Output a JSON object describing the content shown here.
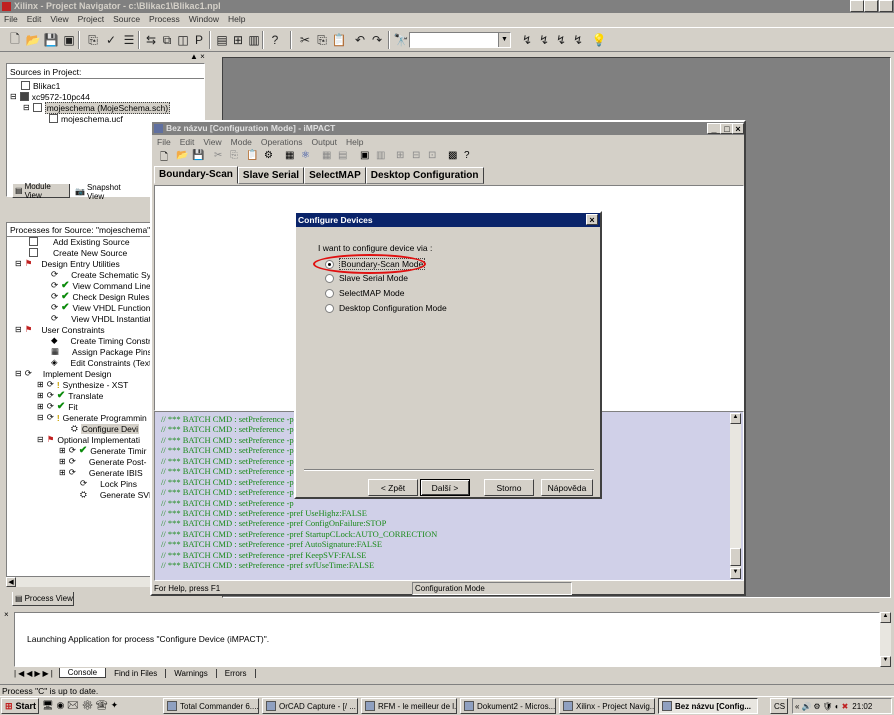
{
  "main_window": {
    "title": "Xilinx - Project Navigator - c:\\Blikac1\\Blikac1.npl",
    "menu": [
      "File",
      "Edit",
      "View",
      "Project",
      "Source",
      "Process",
      "Window",
      "Help"
    ]
  },
  "sources": {
    "header": "Sources in Project:",
    "items": [
      "Blikac1",
      "xc9572-10pc44",
      "mojeschema (MojeSchema.sch)",
      "mojeschema.ucf"
    ],
    "tabs": [
      "Module View",
      "Snapshot View"
    ]
  },
  "processes": {
    "header": "Processes for Source: \"mojeschema\"",
    "items": [
      "Add Existing Source",
      "Create New Source",
      "Design Entry Utilities",
      "Create Schematic Syn",
      "View Command Line I",
      "Check Design Rules",
      "View VHDL Functiona",
      "View VHDL Instantiat",
      "User Constraints",
      "Create Timing Constra",
      "Assign Package Pins",
      "Edit Constraints (Text",
      "Implement Design",
      "Synthesize - XST",
      "Translate",
      "Fit",
      "Generate Programmin",
      "Configure Devi",
      "Optional Implementati",
      "Generate Timir",
      "Generate Post-",
      "Generate IBIS",
      "Lock Pins",
      "Generate SVF/"
    ],
    "tab": "Process View"
  },
  "impact": {
    "title": "Bez názvu [Configuration Mode] - iMPACT",
    "menu": [
      "File",
      "Edit",
      "View",
      "Mode",
      "Operations",
      "Output",
      "Help"
    ],
    "tabs": [
      "Boundary-Scan",
      "Slave Serial",
      "SelectMAP",
      "Desktop Configuration"
    ],
    "log": [
      "// *** BATCH CMD : setPreference -pref UseHighz:FALSE",
      "// *** BATCH CMD : setPreference -pref ConfigOnFailure:STOP",
      "// *** BATCH CMD : setPreference -pref StartupCLock:AUTO_CORRECTION",
      "// *** BATCH CMD : setPreference -pref AutoSignature:FALSE",
      "// *** BATCH CMD : setPreference -pref KeepSVF:FALSE",
      "// *** BATCH CMD : setPreference -pref svfUseTime:FALSE"
    ],
    "log_truncated_prefix": "// *** BATCH CMD : setPreference -p",
    "status_left": "For Help, press F1",
    "status_right": "Configuration Mode"
  },
  "dialog": {
    "title": "Configure Devices",
    "prompt": "I want to configure device via :",
    "options": [
      "Boundary-Scan Mode",
      "Slave Serial Mode",
      "SelectMAP Mode",
      "Desktop Configuration Mode"
    ],
    "selected_index": 0,
    "buttons": {
      "back": "< Zpět",
      "next": "Další >",
      "cancel": "Storno",
      "help": "Nápověda"
    },
    "highlight_color": "#e01010"
  },
  "console": {
    "message": "Launching Application for process \"Configure Device (iMPACT)\".",
    "tabs": [
      "Console",
      "Find in Files",
      "Warnings",
      "Errors"
    ]
  },
  "statusbar": {
    "text": "Process \"C\" is up to date."
  },
  "taskbar": {
    "start": "Start",
    "items": [
      "Total Commander 6....",
      "OrCAD Capture - [/ ...",
      "RFM - le meilleur de l...",
      "Dokument2 - Micros...",
      "Xilinx - Project Navig...",
      "Bez názvu [Config..."
    ],
    "lang": "CS",
    "clock": "21:02"
  },
  "colors": {
    "titlebar": "#0a246a",
    "titlebar_inactive": "#808080",
    "workspace": "#808080",
    "log_bg": "#d0d0e8"
  }
}
